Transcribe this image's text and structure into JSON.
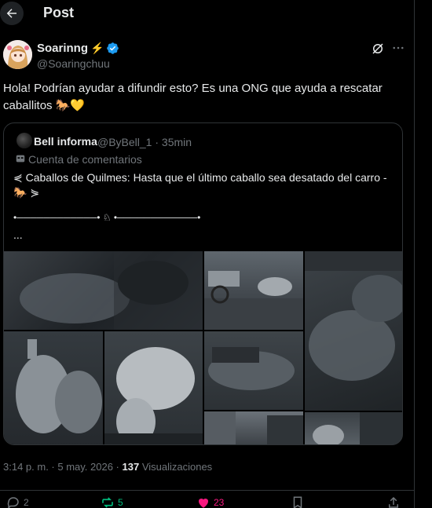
{
  "header": {
    "title": "Post"
  },
  "post": {
    "author_name": "Soarinng",
    "author_badge_emoji": "⚡",
    "handle": "@Soaringchuu",
    "text": "Hola! Podrían ayudar a difundir esto? Es una ONG que ayuda a rescatar caballitos 🐎💛",
    "timestamp": "3:14 p. m. · 5 may. 2026 · ",
    "views_count": "137",
    "views_label": " Visualizaciones"
  },
  "quote": {
    "author_name": "Bell informa",
    "handle_time": "@ByBell_1 · 35min",
    "label": "Cuenta de comentarios",
    "text": "⋞ Caballos de Quilmes: Hasta que el último caballo sea desatado del carro - 🐎 ⋟",
    "divider": "•────────────• ♘ •────────────•",
    "ellipsis": "..."
  },
  "actions": {
    "replies": "2",
    "reposts": "5",
    "likes": "23"
  },
  "colors": {
    "background": "#000000",
    "text": "#e7e9ea",
    "muted": "#71767b",
    "verified": "#1d9bf0",
    "repost": "#00ba7c",
    "like": "#f91880",
    "border": "#2f3336"
  }
}
